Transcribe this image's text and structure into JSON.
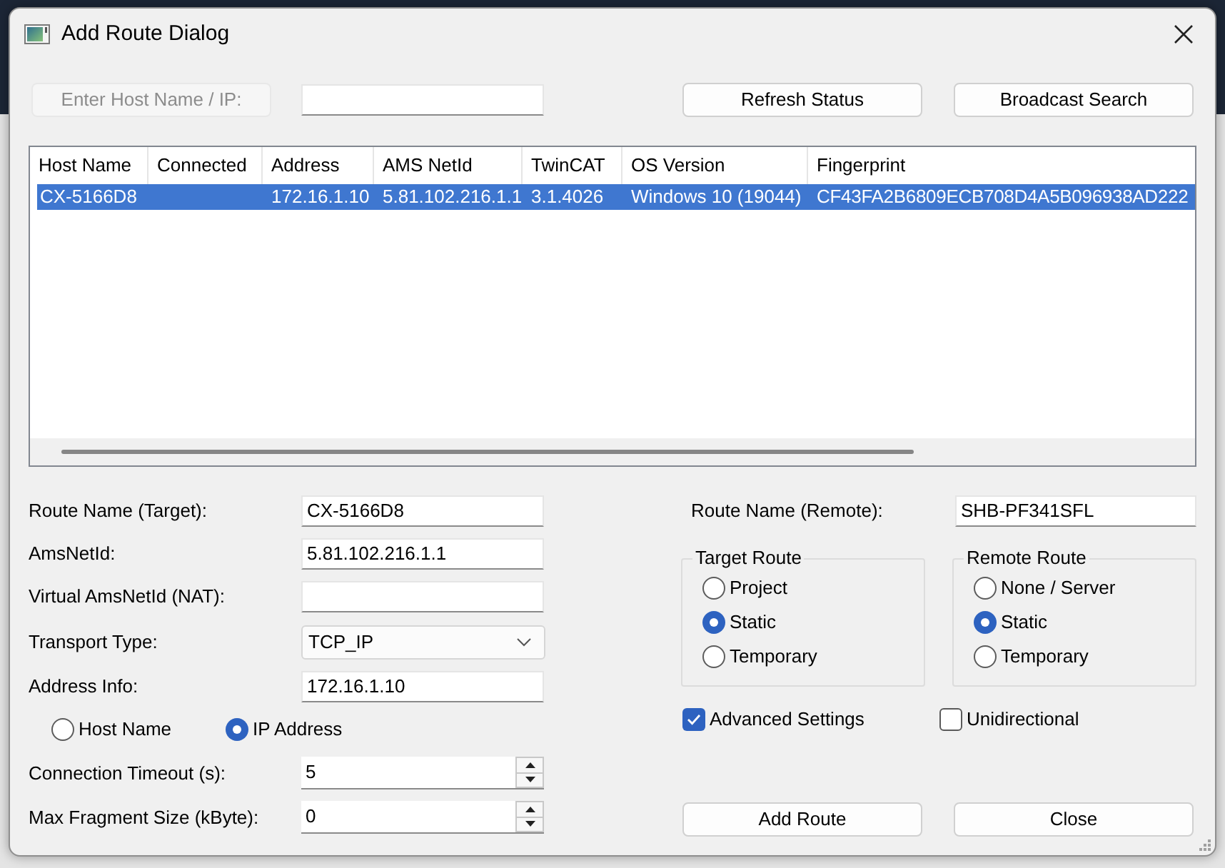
{
  "window": {
    "title": "Add Route Dialog"
  },
  "host_search": {
    "label": "Enter Host Name / IP:",
    "disabled": true
  },
  "top_buttons": [
    {
      "label": "Refresh Status"
    },
    {
      "label": "Broadcast Search"
    }
  ],
  "table": {
    "columns": [
      "Host Name",
      "Connected",
      "Address",
      "AMS NetId",
      "TwinCAT",
      "OS Version",
      "Fingerprint"
    ],
    "rows": [
      {
        "selected": true,
        "cells": [
          "CX-5166D8",
          null,
          "172.16.1.10",
          "5.81.102.216.1.1",
          "3.1.4026",
          "Windows 10 (19044)",
          "CF43FA2B6809ECB708D4A5B096938AD222"
        ]
      }
    ]
  },
  "target_settings": {
    "fields": [
      {
        "kind": "text",
        "label": "Route Name (Target):",
        "value": "CX-5166D8"
      },
      {
        "kind": "text",
        "label": "AmsNetId:",
        "value": "5.81.102.216.1.1"
      },
      {
        "kind": "text",
        "label": "Virtual AmsNetId (NAT):"
      },
      {
        "kind": "select",
        "label": "Transport Type:",
        "value": "TCP_IP"
      },
      {
        "kind": "text",
        "label": "Address Info:",
        "value": "172.16.1.10"
      },
      {
        "kind": "radios",
        "options": [
          {
            "label": "Host Name",
            "selected": false
          },
          {
            "label": "IP Address",
            "selected": true
          }
        ]
      },
      {
        "kind": "spinner",
        "label": "Connection Timeout (s):",
        "value": "5"
      },
      {
        "kind": "spinner",
        "label": "Max Fragment Size (kByte):",
        "value": "0"
      }
    ]
  },
  "remote_settings": {
    "route_name": {
      "label": "Route Name (Remote):",
      "value": "SHB-PF341SFL"
    },
    "groups": [
      {
        "title": "Target Route",
        "options": [
          {
            "label": "Project",
            "selected": false
          },
          {
            "label": "Static",
            "selected": true
          },
          {
            "label": "Temporary",
            "selected": false
          }
        ]
      },
      {
        "title": "Remote Route",
        "options": [
          {
            "label": "None / Server",
            "selected": false
          },
          {
            "label": "Static",
            "selected": true
          },
          {
            "label": "Temporary",
            "selected": false
          }
        ]
      }
    ],
    "checkboxes": [
      {
        "label": "Advanced Settings",
        "checked": true
      },
      {
        "label": "Unidirectional",
        "checked": false
      }
    ]
  },
  "buttons": [
    {
      "label": "Add Route"
    },
    {
      "label": "Close"
    }
  ]
}
